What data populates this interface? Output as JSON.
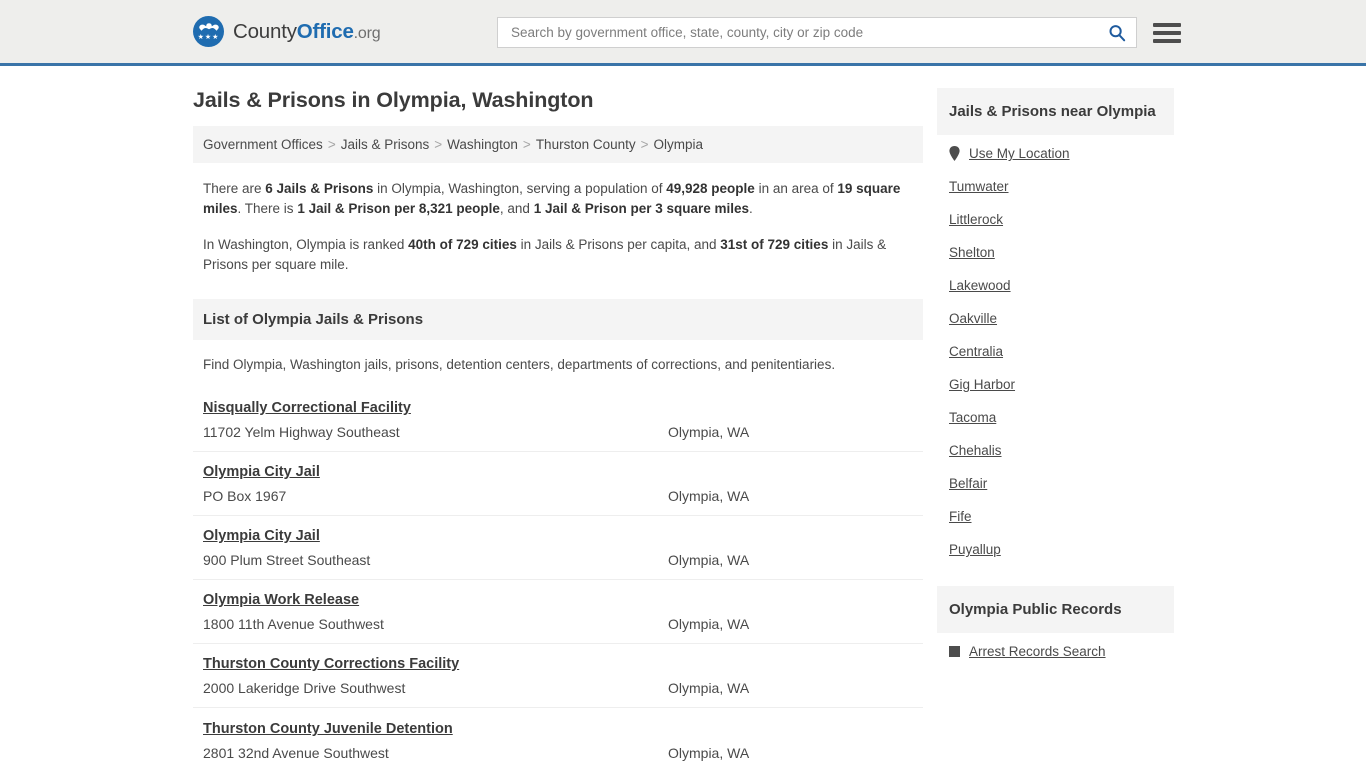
{
  "header": {
    "logo": {
      "part1": "County",
      "part2": "Office",
      "part3": ".org",
      "icon": "eagle-seal-logo"
    },
    "search": {
      "placeholder": "Search by government office, state, county, city or zip code",
      "value": "",
      "icon": "search-icon"
    },
    "menu_icon": "hamburger-menu-icon",
    "accent_color": "#3a74a8",
    "background_color": "#eeeeec"
  },
  "main": {
    "title": "Jails & Prisons in Olympia, Washington",
    "breadcrumb": [
      "Government Offices",
      "Jails & Prisons",
      "Washington",
      "Thurston County",
      "Olympia"
    ],
    "breadcrumb_separator": ">",
    "intro_paragraph_1": {
      "segments": [
        {
          "text": "There are ",
          "bold": false
        },
        {
          "text": "6 Jails & Prisons",
          "bold": true
        },
        {
          "text": " in Olympia, Washington, serving a population of ",
          "bold": false
        },
        {
          "text": "49,928 people",
          "bold": true
        },
        {
          "text": " in an area of ",
          "bold": false
        },
        {
          "text": "19 square miles",
          "bold": true
        },
        {
          "text": ". There is ",
          "bold": false
        },
        {
          "text": "1 Jail & Prison per 8,321 people",
          "bold": true
        },
        {
          "text": ", and ",
          "bold": false
        },
        {
          "text": "1 Jail & Prison per 3 square miles",
          "bold": true
        },
        {
          "text": ".",
          "bold": false
        }
      ]
    },
    "intro_paragraph_2": {
      "segments": [
        {
          "text": "In Washington, Olympia is ranked ",
          "bold": false
        },
        {
          "text": "40th of 729 cities",
          "bold": true
        },
        {
          "text": " in Jails & Prisons per capita, and ",
          "bold": false
        },
        {
          "text": "31st of 729 cities",
          "bold": true
        },
        {
          "text": " in Jails & Prisons per square mile.",
          "bold": false
        }
      ]
    },
    "section_title": "List of Olympia Jails & Prisons",
    "section_subtitle": "Find Olympia, Washington jails, prisons, detention centers, departments of corrections, and penitentiaries.",
    "listings": [
      {
        "name": "Nisqually Correctional Facility",
        "address": "11702 Yelm Highway Southeast",
        "city": "Olympia, WA"
      },
      {
        "name": "Olympia City Jail",
        "address": "PO Box 1967",
        "city": "Olympia, WA"
      },
      {
        "name": "Olympia City Jail",
        "address": "900 Plum Street Southeast",
        "city": "Olympia, WA"
      },
      {
        "name": "Olympia Work Release",
        "address": "1800 11th Avenue Southwest",
        "city": "Olympia, WA"
      },
      {
        "name": "Thurston County Corrections Facility",
        "address": "2000 Lakeridge Drive Southwest",
        "city": "Olympia, WA"
      },
      {
        "name": "Thurston County Juvenile Detention",
        "address": "2801 32nd Avenue Southwest",
        "city": "Olympia, WA"
      }
    ]
  },
  "sidebar": {
    "nearby": {
      "title": "Jails & Prisons near Olympia",
      "use_my_location": {
        "label": "Use My Location",
        "icon": "map-pin-icon"
      },
      "cities": [
        "Tumwater",
        "Littlerock",
        "Shelton",
        "Lakewood",
        "Oakville",
        "Centralia",
        "Gig Harbor",
        "Tacoma",
        "Chehalis",
        "Belfair",
        "Fife",
        "Puyallup"
      ]
    },
    "public_records": {
      "title": "Olympia Public Records",
      "links": [
        {
          "label": "Arrest Records Search",
          "icon": "square-bullet-icon"
        }
      ]
    }
  }
}
